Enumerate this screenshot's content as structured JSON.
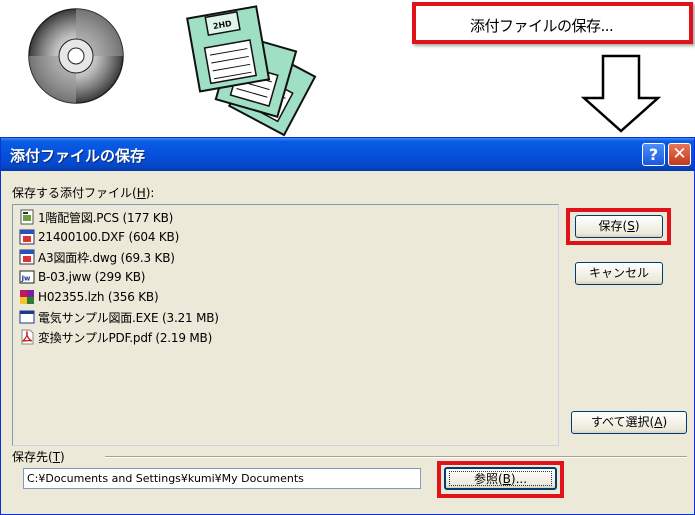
{
  "menu": {
    "item_label": "添付ファイルの保存..."
  },
  "dialog": {
    "title": "添付ファイルの保存",
    "help_glyph": "?",
    "close_glyph": "✕",
    "files_label_prefix": "保存する添付ファイル(",
    "files_label_key": "H",
    "files_label_suffix": "):",
    "files": [
      {
        "name": "1階配管図.PCS (177 KB)",
        "icon": "pcs-file-icon"
      },
      {
        "name": "21400100.DXF (604 KB)",
        "icon": "dxf-file-icon"
      },
      {
        "name": "A3図面枠.dwg (69.3 KB)",
        "icon": "dwg-file-icon"
      },
      {
        "name": "B-03.jww (299 KB)",
        "icon": "jww-file-icon"
      },
      {
        "name": "H02355.lzh (356 KB)",
        "icon": "lzh-archive-icon"
      },
      {
        "name": "電気サンプル図面.EXE (3.21 MB)",
        "icon": "exe-window-icon"
      },
      {
        "name": "変換サンプルPDF.pdf (2.19 MB)",
        "icon": "pdf-file-icon"
      }
    ],
    "save_prefix": "保存(",
    "save_key": "S",
    "save_suffix": ")",
    "cancel_label": "キャンセル",
    "select_all_prefix": "すべて選択(",
    "select_all_key": "A",
    "select_all_suffix": ")",
    "dest_label_prefix": "保存先(",
    "dest_label_key": "T",
    "dest_label_suffix": ")",
    "dest_path": "C:¥Documents and Settings¥kumi¥My Documents",
    "browse_prefix": "参照(",
    "browse_key": "B",
    "browse_suffix": ")..."
  },
  "colors": {
    "highlight_frame": "#e0121a",
    "titlebar": "#0550dc",
    "dialog_bg": "#ece9d8"
  }
}
